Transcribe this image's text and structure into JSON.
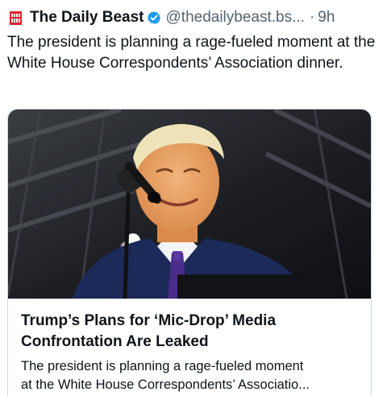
{
  "post": {
    "author_name": "The Daily Beast",
    "handle": "@thedailybeast.bs...",
    "separator": "·",
    "time": "9h",
    "text": "The president is planning a rage-fueled moment at the White House Correspondents’ Association dinner.",
    "avatar_icon": "daily-beast-logo-icon",
    "verified_icon": "verified-badge-icon"
  },
  "link_card": {
    "title": "Trump’s Plans for ‘Mic-Drop’ Media Confrontation Are Leaked",
    "description_line1": "The president is planning a rage-fueled moment",
    "description_line2": "at the White House Correspondents’ Associatio..."
  },
  "colors": {
    "text": "#0f1419",
    "secondary": "#536471",
    "verified": "#1d9bf0",
    "brand": "#d8262e",
    "card_border": "#cfd9de"
  }
}
